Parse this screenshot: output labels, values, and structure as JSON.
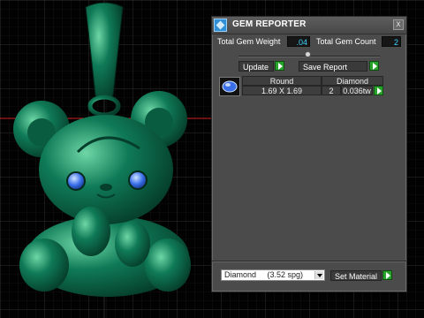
{
  "panel": {
    "title": "GEM REPORTER",
    "close_glyph": "x"
  },
  "stats": {
    "total_weight_label": "Total Gem Weight",
    "total_weight_value": ".04",
    "total_count_label": "Total Gem Count",
    "total_count_value": "2"
  },
  "actions": {
    "update_label": "Update",
    "save_report_label": "Save Report"
  },
  "gems": {
    "rows": [
      {
        "thumb_icon": "round-gem-icon",
        "shape": "Round",
        "size": "1.69 X 1.69",
        "material": "Diamond",
        "count": "2",
        "weight": "0.036tw"
      }
    ]
  },
  "material": {
    "selected": "Diamond     (3.52 spg)",
    "set_label": "Set Material"
  },
  "colors": {
    "model": "#0f7a57",
    "grid": "#f1f1f1",
    "axis_red": "#d21f1f",
    "accent_go": "#27a32b",
    "value_text": "#3fd2ff",
    "gem_blue": "#3a6fe8"
  }
}
